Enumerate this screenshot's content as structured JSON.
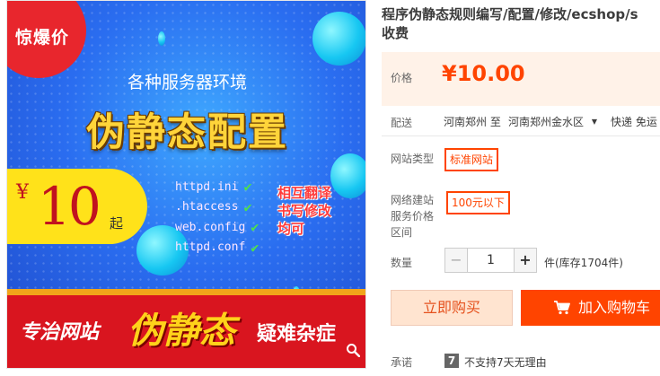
{
  "product_image": {
    "burst": "惊爆价",
    "subtitle": "各种服务器环境",
    "headline": "伪静态配置",
    "price_yen": "¥",
    "price_num": "10",
    "price_suffix": "起",
    "files": [
      "httpd.ini",
      ".htaccess",
      "web.config",
      "httpd.conf"
    ],
    "side_notes": [
      "相互翻译",
      "书写修改",
      "均可"
    ],
    "banner_left": "专治网站",
    "banner_mid": "伪静态",
    "banner_right": "疑难杂症"
  },
  "detail": {
    "title_line1": "程序伪静态规则编写/配置/修改/ecshop/s",
    "title_line2": "收费",
    "price_label": "价格",
    "price": "¥10.00",
    "ship_label": "配送",
    "ship_from": "河南郑州 至",
    "ship_to": "河南郑州金水区",
    "ship_method": "快递 免运",
    "type_label": "网站类型",
    "type_option": "标准网站",
    "price_range_label_1": "网络建站",
    "price_range_label_2": "服务价格",
    "price_range_label_3": "区间",
    "price_range_option": "100元以下",
    "qty_label": "数量",
    "qty_minus": "−",
    "qty_value": "1",
    "qty_plus": "+",
    "qty_unit": "件(库存1704件)",
    "buy_now": "立即购买",
    "add_cart": "加入购物车",
    "promise_label": "承诺",
    "promise_badge": "7",
    "promise_text": "不支持7天无理由"
  },
  "colors": {
    "accent": "#ff4400",
    "price_bg": "#fff2e8",
    "image_blue": "#2a6df0",
    "banner_red": "#d9151f",
    "yellow": "#ffd43a"
  }
}
